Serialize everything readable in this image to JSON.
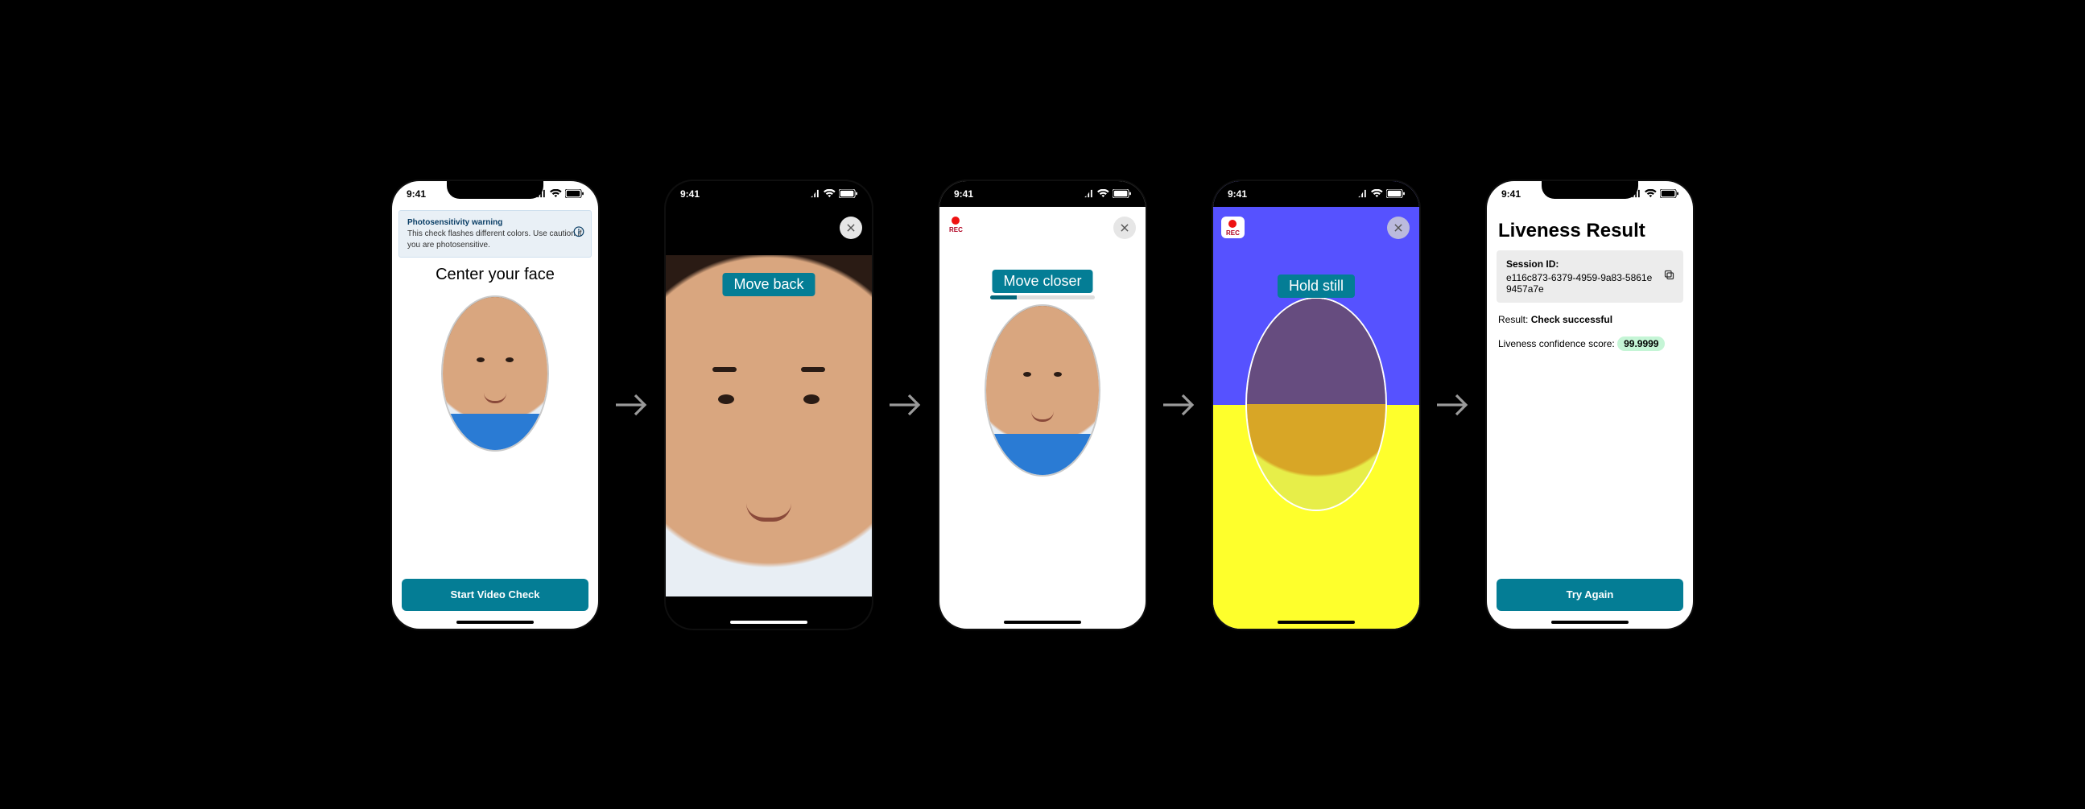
{
  "status_time": "9:41",
  "screens": {
    "s1": {
      "warning_title": "Photosensitivity warning",
      "warning_body": "This check flashes different colors. Use caution if you are photosensitive.",
      "heading": "Center your face",
      "cta": "Start Video Check"
    },
    "s2": {
      "hint": "Move back"
    },
    "s3": {
      "rec_label": "REC",
      "hint": "Move closer",
      "progress_percent": 25
    },
    "s4": {
      "rec_label": "REC",
      "hint": "Hold still",
      "flash_top_color": "#5652ff",
      "flash_bottom_color": "#feff2c"
    },
    "s5": {
      "title": "Liveness Result",
      "session_label": "Session ID:",
      "session_id": "e116c873-6379-4959-9a83-5861e9457a7e",
      "result_label": "Result:",
      "result_value": "Check successful",
      "score_label": "Liveness confidence score:",
      "score_value": "99.9999",
      "cta": "Try Again"
    }
  }
}
